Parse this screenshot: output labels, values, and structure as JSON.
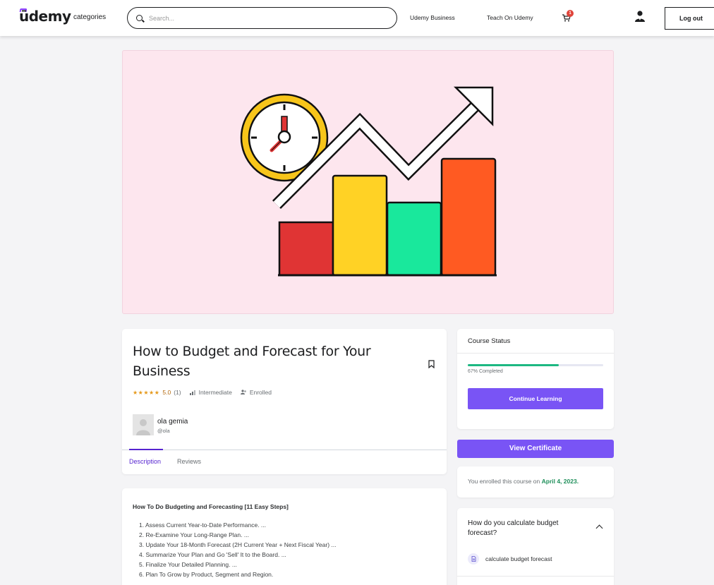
{
  "header": {
    "logo_text": "ūdemy",
    "categories_label": "categories",
    "search_placeholder": "Search...",
    "udemy_business_label": "Udemy Business",
    "teach_label": "Teach On Udemy",
    "cart_count": "1",
    "logout_label": "Log out"
  },
  "course": {
    "title": "How to Budget and Forecast for Your Business",
    "stars": "★★★★★",
    "rating": "5.0",
    "rating_count": "(1)",
    "level": "Intermediate",
    "enrollment_status": "Enrolled",
    "author_name": "ola gemia",
    "author_handle": "@ola",
    "tabs": [
      {
        "label": "Description"
      },
      {
        "label": "Reviews"
      }
    ]
  },
  "description": {
    "heading": "How To Do Budgeting and Forecasting [11 Easy Steps]",
    "items": [
      "1. Assess Current Year-to-Date Performance. ...",
      "2. Re-Examine Your Long-Range Plan. ...",
      "3. Update Your 18-Month Forecast (2H Current Year + Next Fiscal Year) ...",
      "4. Summarize Your Plan and Go 'Sell' It to the Board. ...",
      "5. Finalize Your Detailed Planning. ...",
      "6. Plan To Grow by Product, Segment and Region."
    ]
  },
  "status": {
    "title": "Course Status",
    "progress_fraction": 0.67,
    "progress_text": "67% Completed",
    "continue_label": "Continue Learning",
    "certificate_label": "View Certificate",
    "enrolled_prefix": "You enrolled this course on",
    "enrolled_date": "April 4, 2023",
    "enrolled_suffix": "."
  },
  "faq": {
    "question": "How do you calculate budget forecast?",
    "item_label": "calculate budget forecast"
  },
  "colors": {
    "accent": "#7954f5",
    "hero_bg": "#fde6ee",
    "progress": "#1db882",
    "bar_red": "#e03434",
    "bar_yellow": "#ffd225",
    "bar_green": "#19e89c",
    "bar_orange": "#ff5a22",
    "clock_ring": "#f7c51a"
  }
}
